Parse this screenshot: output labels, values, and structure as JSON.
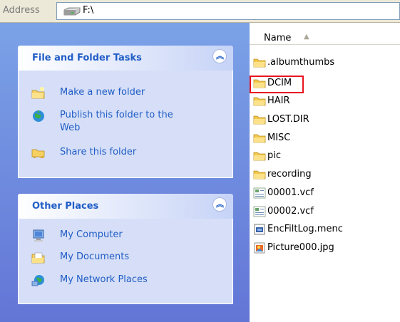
{
  "address_bar": {
    "label": "Address",
    "value": "F:\\",
    "icon": "drive-icon"
  },
  "tasks_panel": {
    "title": "File and Folder Tasks",
    "collapse_icon": "chevron-up-icon",
    "items": [
      {
        "label": "Make a new folder",
        "icon": "new-folder-icon"
      },
      {
        "label": "Publish this folder to the",
        "label2": "Web",
        "icon": "publish-web-icon"
      },
      {
        "label": "Share this folder",
        "icon": "share-folder-icon"
      }
    ]
  },
  "places_panel": {
    "title": "Other Places",
    "collapse_icon": "chevron-up-icon",
    "items": [
      {
        "label": "My Computer",
        "icon": "computer-icon"
      },
      {
        "label": "My Documents",
        "icon": "documents-icon"
      },
      {
        "label": "My Network Places",
        "icon": "network-icon"
      }
    ]
  },
  "file_list": {
    "column_header": "Name",
    "sort_indicator": "ascending",
    "items": [
      {
        "name": ".albumthumbs",
        "icon": "folder-icon"
      },
      {
        "name": "DCIM",
        "icon": "folder-icon",
        "highlighted": true
      },
      {
        "name": "HAIR",
        "icon": "folder-icon"
      },
      {
        "name": "LOST.DIR",
        "icon": "folder-icon"
      },
      {
        "name": "MISC",
        "icon": "folder-icon"
      },
      {
        "name": "pic",
        "icon": "folder-icon"
      },
      {
        "name": "recording",
        "icon": "folder-icon"
      },
      {
        "name": "00001.vcf",
        "icon": "vcard-icon"
      },
      {
        "name": "00002.vcf",
        "icon": "vcard-icon"
      },
      {
        "name": "EncFiltLog.menc",
        "icon": "data-file-icon"
      },
      {
        "name": "Picture000.jpg",
        "icon": "image-file-icon"
      }
    ]
  },
  "colors": {
    "highlight_border": "#e8141e",
    "link_blue": "#215dc6",
    "pane_gradient_top": "#7ba2e7",
    "pane_gradient_bottom": "#6375d6"
  }
}
